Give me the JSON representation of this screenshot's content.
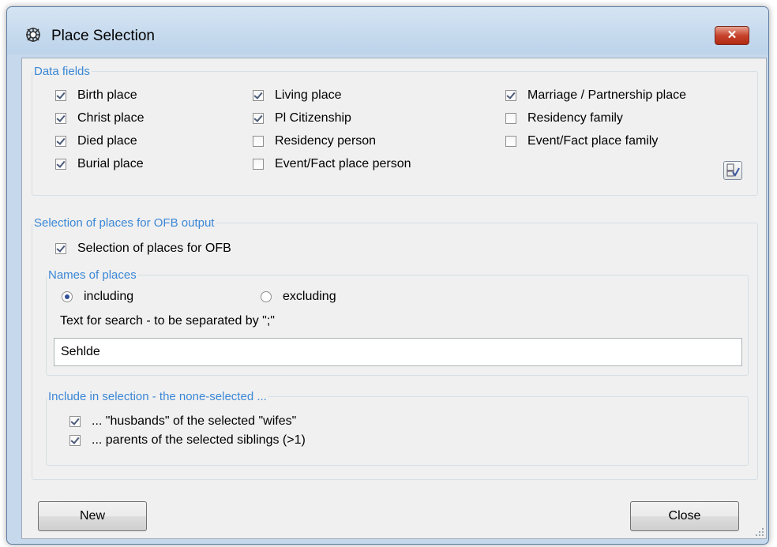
{
  "window": {
    "title": "Place Selection",
    "close_glyph": "✕"
  },
  "data_fields": {
    "legend": "Data fields",
    "col1": [
      {
        "label": "Birth place",
        "checked": true
      },
      {
        "label": "Christ place",
        "checked": true
      },
      {
        "label": "Died place",
        "checked": true
      },
      {
        "label": "Burial place",
        "checked": true
      }
    ],
    "col2": [
      {
        "label": "Living place",
        "checked": true
      },
      {
        "label": "Pl Citizenship",
        "checked": true
      },
      {
        "label": "Residency person",
        "checked": false
      },
      {
        "label": "Event/Fact place person",
        "checked": false
      }
    ],
    "col3": [
      {
        "label": "Marriage / Partnership place",
        "checked": true
      },
      {
        "label": "Residency family",
        "checked": false
      },
      {
        "label": "Event/Fact place family",
        "checked": false
      }
    ],
    "toggle_icon": "toggle-check-icon"
  },
  "ofb": {
    "legend": "Selection of places for OFB output",
    "checkbox_label": "Selection of places for OFB",
    "checked": true,
    "names": {
      "legend": "Names of places",
      "including": "including",
      "excluding": "excluding",
      "selected": "including",
      "search_label": "Text for search - to be separated by \";\"",
      "search_value": "Sehlde"
    },
    "include": {
      "legend": "Include in selection - the none-selected ...",
      "items": [
        {
          "label": "... \"husbands\" of the selected \"wifes\"",
          "checked": true
        },
        {
          "label": "... parents of the selected siblings (>1)",
          "checked": true
        }
      ]
    }
  },
  "buttons": {
    "new_label": "New",
    "close_label": "Close"
  }
}
